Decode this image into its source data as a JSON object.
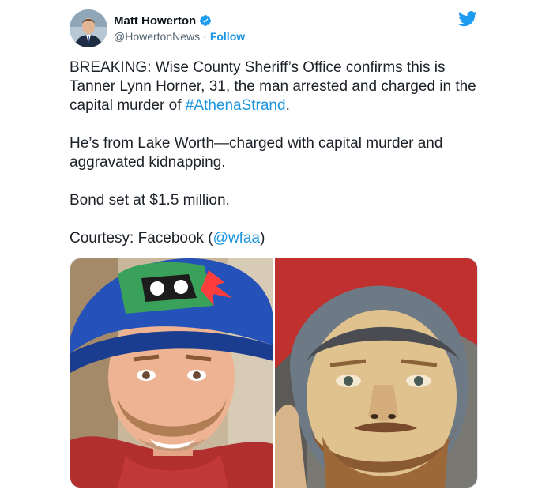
{
  "tweet": {
    "author": {
      "name": "Matt Howerton",
      "handle": "@HowertonNews",
      "separator": "·",
      "follow_label": "Follow",
      "avatar_icon": "profile-photo",
      "verified_icon": "verified-badge-icon"
    },
    "brand_icon": "twitter-bird-icon",
    "colors": {
      "link": "#1b95e0",
      "verified": "#1d9bf0",
      "text": "#1c2228",
      "muted": "#536471"
    },
    "paragraph1": {
      "text_before": "BREAKING: Wise County Sheriff’s Office confirms this is Tanner Lynn Horner, 31, the man arrested and charged in the capital murder of ",
      "hashtag": "#AthenaStrand",
      "text_after": "."
    },
    "paragraph2": "He’s from Lake Worth—charged with capital murder and aggravated kidnapping.",
    "paragraph3": "Bond set at $1.5 million.",
    "paragraph4": {
      "text_before": "Courtesy: Facebook (",
      "mention": "@wfaa",
      "text_after": ")"
    },
    "media": {
      "photos": [
        {
          "icon": "photo-man-blue-cap"
        },
        {
          "icon": "photo-man-red-cap"
        }
      ]
    }
  }
}
